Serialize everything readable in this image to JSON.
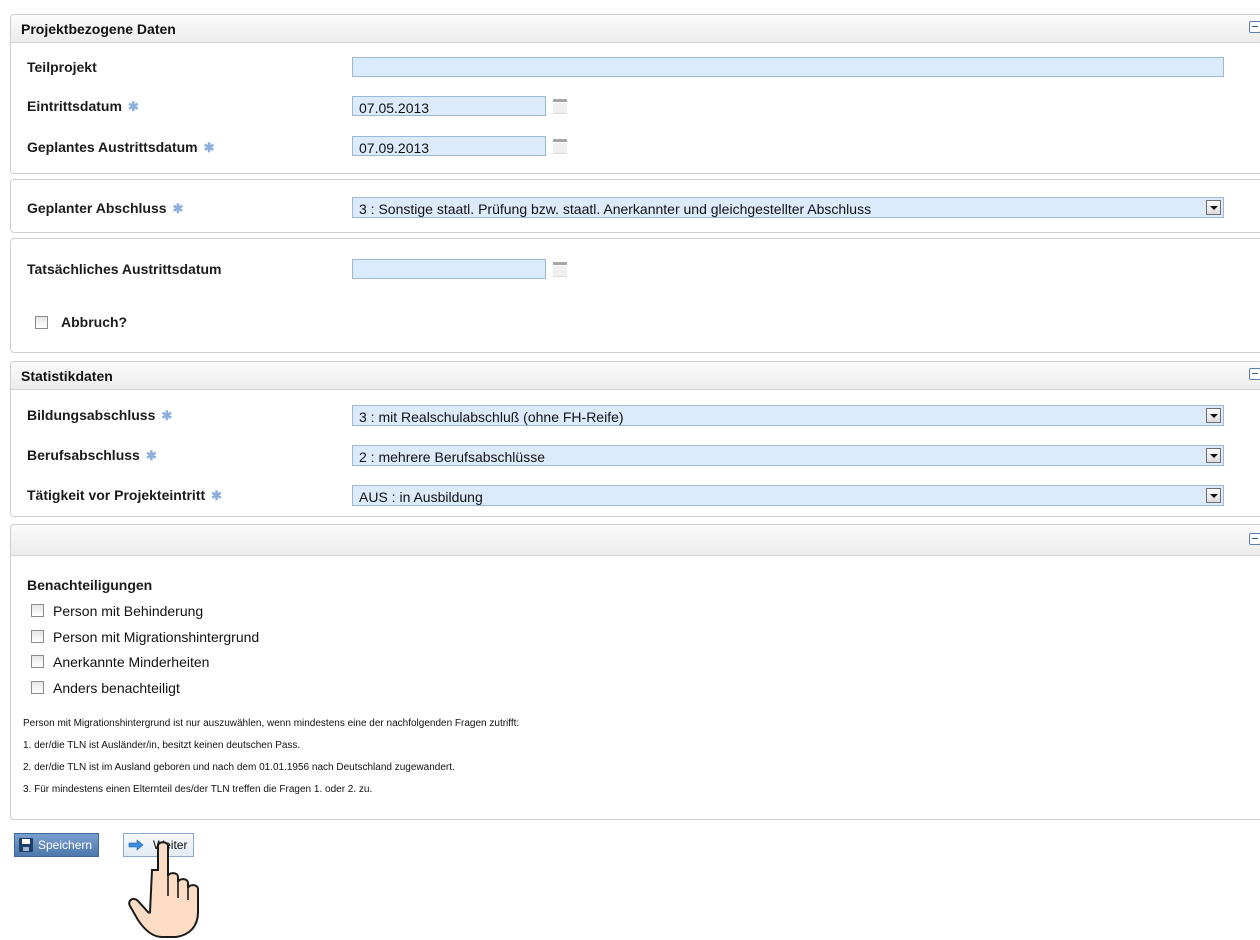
{
  "project_panel": {
    "title": "Projektbezogene Daten",
    "teilprojekt_label": "Teilprojekt",
    "teilprojekt_value": "",
    "eintritt_label": "Eintrittsdatum",
    "eintritt_value": "07.05.2013",
    "austritt_label": "Geplantes Austrittsdatum",
    "austritt_value": "07.09.2013",
    "required_marker": "✱"
  },
  "abschluss_panel": {
    "label": "Geplanter Abschluss",
    "value": "3 : Sonstige staatl. Prüfung bzw. staatl. Anerkannter und gleichgestellter Abschluss"
  },
  "exit_panel": {
    "tats_label": "Tatsächliches Austrittsdatum",
    "tats_value": "",
    "abbruch_label": "Abbruch?"
  },
  "statistik_panel": {
    "title": "Statistikdaten",
    "bildung_label": "Bildungsabschluss",
    "bildung_value": "3 : mit Realschulabschluß (ohne FH-Reife)",
    "beruf_label": "Berufsabschluss",
    "beruf_value": "2 : mehrere Berufsabschlüsse",
    "taetigkeit_label": "Tätigkeit vor Projekteintritt",
    "taetigkeit_value": "AUS : in Ausbildung"
  },
  "benachteiligungen_panel": {
    "heading": "Benachteiligungen",
    "options": [
      "Person mit Behinderung",
      "Person mit Migrationshintergrund",
      "Anerkannte Minderheiten",
      "Anders benachteiligt"
    ],
    "notes": [
      "Person mit Migrationshintergrund ist nur auszuwählen, wenn mindestens eine der nachfolgenden Fragen zutrifft:",
      "1. der/die TLN ist Ausländer/in, besitzt keinen deutschen Pass.",
      "2. der/die TLN  ist im Ausland geboren und nach dem 01.01.1956 nach Deutschland zugewandert.",
      "3. Für mindestens einen Elternteil des/der TLN treffen die Fragen 1. oder 2. zu."
    ]
  },
  "buttons": {
    "save_label": "Speichern",
    "next_label": "Weiter"
  },
  "colors": {
    "field_bg": "#dcebfb",
    "required": "#8fb0dd",
    "save_button": "#4d78ad"
  }
}
